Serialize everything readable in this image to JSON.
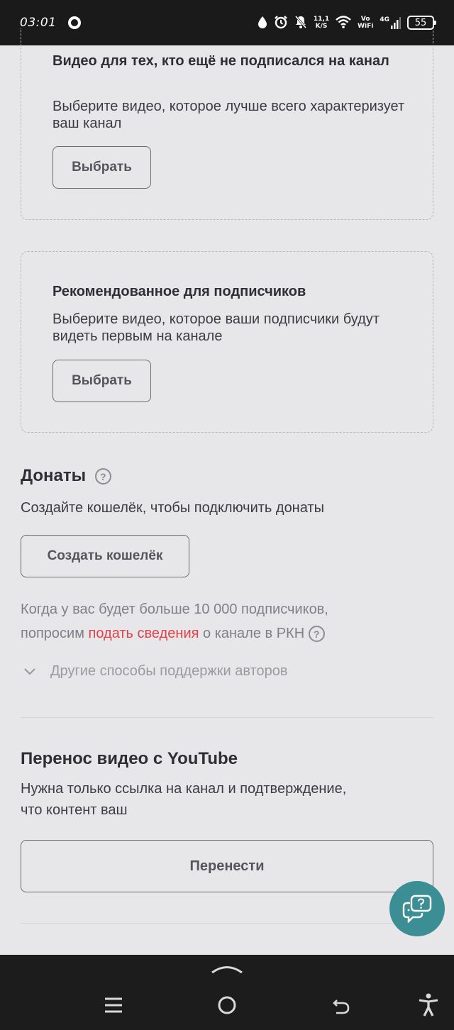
{
  "status": {
    "time": "03:01",
    "net_speed_value": "11,1",
    "net_speed_unit": "K/S",
    "vo": "Vo",
    "wifi": "WiFi",
    "network": "4G",
    "battery": "55"
  },
  "cards": [
    {
      "title": "Видео для тех, кто ещё не подписался на канал",
      "description": "Выберите видео, которое лучше всего характеризует ваш канал",
      "button": "Выбрать"
    },
    {
      "title": "Рекомендованное для подписчиков",
      "description": "Выберите видео, которое ваши подписчики будут видеть первым на канале",
      "button": "Выбрать"
    }
  ],
  "donations": {
    "title": "Донаты",
    "help": "?",
    "subtitle": "Создайте кошелёк, чтобы подключить донаты",
    "button": "Создать кошелёк",
    "notice_part1": "Когда у вас будет больше 10 000 подписчиков,",
    "notice_part2": "попросим",
    "notice_link": "подать сведения",
    "notice_part3": "о канале в РКН",
    "other_ways": "Другие способы поддержки авторов"
  },
  "youtube": {
    "title": "Перенос видео с YouTube",
    "description_line1": "Нужна только ссылка на канал и подтверждение,",
    "description_line2": "что контент ваш",
    "button": "Перенести"
  },
  "icons": {
    "help": "question-circle-icon",
    "chevron": "chevron-down-icon",
    "support": "chat-question-icon"
  },
  "colors": {
    "background": "#e7e7ea",
    "link": "#e0424c",
    "fab": "#3b8f94"
  }
}
